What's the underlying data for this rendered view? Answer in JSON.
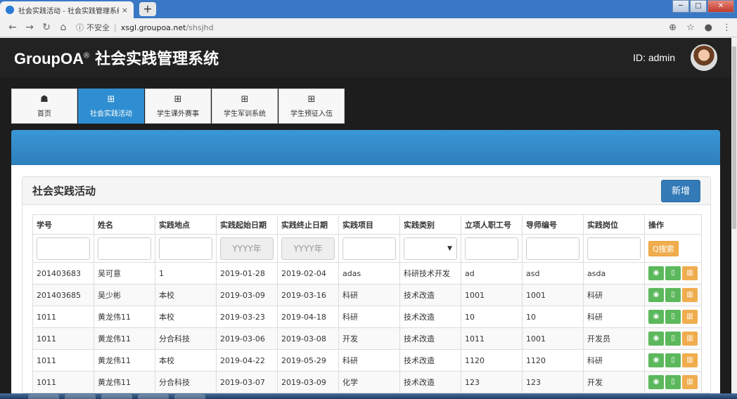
{
  "browser": {
    "tab_title": "社会实践活动 - 社会实践管理系统",
    "tab_close": "×",
    "new_tab": "+",
    "security_label": "不安全",
    "url_host": "xsgl.groupoa.net",
    "url_path": "/shsjhd"
  },
  "header": {
    "brand": "GroupOA",
    "reg": "®",
    "system_name": "社会实践管理系统",
    "user_id": "ID: admin"
  },
  "modules": [
    {
      "label": "首页",
      "icon": "home-icon",
      "glyph": "☗",
      "active": false
    },
    {
      "label": "社会实践活动",
      "icon": "grid-icon",
      "glyph": "⊞",
      "active": true
    },
    {
      "label": "学生课外赛事",
      "icon": "grid-icon",
      "glyph": "⊞",
      "active": false
    },
    {
      "label": "学生军训系统",
      "icon": "grid-icon",
      "glyph": "⊞",
      "active": false
    },
    {
      "label": "学生预征入伍",
      "icon": "grid-icon",
      "glyph": "⊞",
      "active": false
    }
  ],
  "panel": {
    "title": "社会实践活动",
    "new_button": "新增"
  },
  "table": {
    "columns": [
      "学号",
      "姓名",
      "实践地点",
      "实践起始日期",
      "实践终止日期",
      "实践项目",
      "实践类别",
      "立项人职工号",
      "导师编号",
      "实践岗位",
      "操作"
    ],
    "date_placeholder": "YYYY年",
    "select_arrow": "▼",
    "search_label": "Q搜索",
    "rows": [
      [
        "201403683",
        "吴可意",
        "1",
        "2019-01-28",
        "2019-02-04",
        "adas",
        "科研技术开发",
        "ad",
        "asd",
        "asda"
      ],
      [
        "201403685",
        "吴少彬",
        "本校",
        "2019-03-09",
        "2019-03-16",
        "科研",
        "技术改造",
        "1001",
        "1001",
        "科研"
      ],
      [
        "1011",
        "黄龙伟11",
        "本校",
        "2019-03-23",
        "2019-04-18",
        "科研",
        "技术改造",
        "10",
        "10",
        "科研"
      ],
      [
        "1011",
        "黄龙伟11",
        "分合科技",
        "2019-03-06",
        "2019-03-08",
        "开发",
        "技术改造",
        "1011",
        "1001",
        "开发员"
      ],
      [
        "1011",
        "黄龙伟11",
        "本校",
        "2019-04-22",
        "2019-05-29",
        "科研",
        "技术改造",
        "1120",
        "1120",
        "科研"
      ],
      [
        "1011",
        "黄龙伟11",
        "分合科技",
        "2019-03-07",
        "2019-03-09",
        "化学",
        "技术改造",
        "123",
        "123",
        "开发"
      ]
    ]
  },
  "colors": {
    "accent": "#2e8ed1",
    "header_bg": "#222222",
    "new_button": "#337ab7",
    "view_button": "#5cb85c",
    "delete_button": "#f0ad4e"
  }
}
